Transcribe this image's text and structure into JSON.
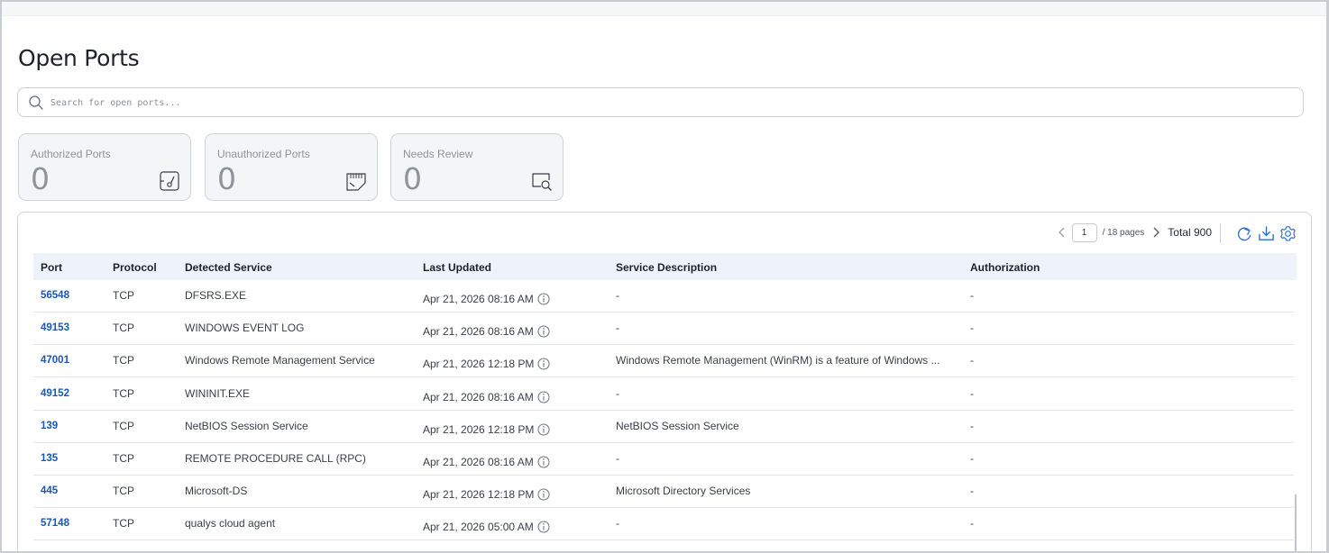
{
  "page": {
    "title": "Open Ports"
  },
  "search": {
    "placeholder": "Search for open ports..."
  },
  "cards": [
    {
      "label": "Authorized Ports",
      "value": "0",
      "icon": "authorized-port-icon"
    },
    {
      "label": "Unauthorized Ports",
      "value": "0",
      "icon": "unauthorized-port-icon"
    },
    {
      "label": "Needs Review",
      "value": "0",
      "icon": "review-icon"
    }
  ],
  "pager": {
    "page": "1",
    "pages_label": "/  18 pages",
    "total": "Total 900"
  },
  "toolbar": {
    "icons": [
      "refresh-icon",
      "download-icon",
      "settings-icon"
    ]
  },
  "table": {
    "columns": [
      "Port",
      "Protocol",
      "Detected Service",
      "Last Updated",
      "Service Description",
      "Authorization"
    ],
    "rows": [
      {
        "port": "56548",
        "protocol": "TCP",
        "service": "DFSRS.EXE",
        "updated": "Apr 21, 2026 08:16 AM",
        "description": "-",
        "authorization": "-"
      },
      {
        "port": "49153",
        "protocol": "TCP",
        "service": "WINDOWS EVENT LOG",
        "updated": "Apr 21, 2026 08:16 AM",
        "description": "-",
        "authorization": "-"
      },
      {
        "port": "47001",
        "protocol": "TCP",
        "service": "Windows Remote Management Service",
        "updated": "Apr 21, 2026 12:18 PM",
        "description": "Windows Remote Management (WinRM) is a feature of Windows ...",
        "authorization": "-"
      },
      {
        "port": "49152",
        "protocol": "TCP",
        "service": "WININIT.EXE",
        "updated": "Apr 21, 2026 08:16 AM",
        "description": "-",
        "authorization": "-"
      },
      {
        "port": "139",
        "protocol": "TCP",
        "service": "NetBIOS Session Service",
        "updated": "Apr 21, 2026 12:18 PM",
        "description": "NetBIOS Session Service",
        "authorization": "-"
      },
      {
        "port": "135",
        "protocol": "TCP",
        "service": "REMOTE PROCEDURE CALL (RPC)",
        "updated": "Apr 21, 2026 08:16 AM",
        "description": "-",
        "authorization": "-"
      },
      {
        "port": "445",
        "protocol": "TCP",
        "service": "Microsoft-DS",
        "updated": "Apr 21, 2026 12:18 PM",
        "description": "Microsoft Directory Services",
        "authorization": "-"
      },
      {
        "port": "57148",
        "protocol": "TCP",
        "service": "qualys cloud agent",
        "updated": "Apr 21, 2026 05:00 AM",
        "description": "-",
        "authorization": "-"
      }
    ]
  },
  "colors": {
    "link": "#1a56b8",
    "header_bg": "#eef3fb",
    "icon_blue": "#2b6cd0"
  }
}
